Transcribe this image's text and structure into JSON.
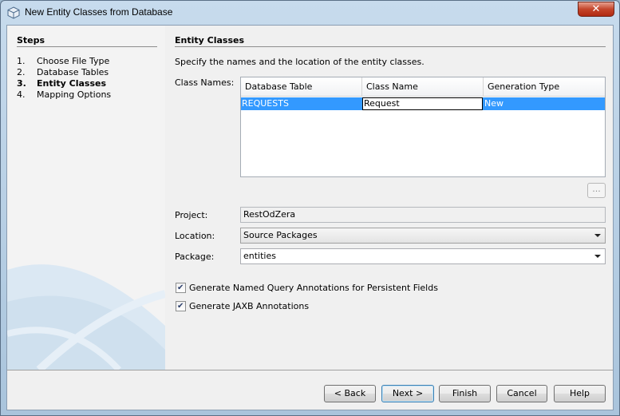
{
  "window": {
    "title": "New Entity Classes from Database",
    "close_glyph": "✕"
  },
  "steps": {
    "title": "Steps",
    "items": [
      {
        "num": "1.",
        "label": "Choose File Type",
        "current": false
      },
      {
        "num": "2.",
        "label": "Database Tables",
        "current": false
      },
      {
        "num": "3.",
        "label": "Entity Classes",
        "current": true
      },
      {
        "num": "4.",
        "label": "Mapping Options",
        "current": false
      }
    ]
  },
  "panel": {
    "title": "Entity Classes",
    "description": "Specify the names and the location of the entity classes.",
    "class_names_label": "Class Names:",
    "table": {
      "columns": [
        "Database Table",
        "Class Name",
        "Generation Type"
      ],
      "rows": [
        [
          "REQUESTS",
          "Request",
          "New"
        ]
      ]
    },
    "ellipsis_label": "...",
    "project_label": "Project:",
    "project_value": "RestOdZera",
    "location_label": "Location:",
    "location_value": "Source Packages",
    "package_label": "Package:",
    "package_value": "entities",
    "checkboxes": [
      {
        "label": "Generate Named Query Annotations for Persistent Fields",
        "checked": true
      },
      {
        "label": "Generate JAXB Annotations",
        "checked": true
      }
    ]
  },
  "buttons": {
    "back": "< Back",
    "next": "Next >",
    "finish": "Finish",
    "cancel": "Cancel",
    "help": "Help"
  },
  "colors": {
    "selection": "#3399ff",
    "title_bar": "#bcd3e8",
    "close": "#c4452b"
  },
  "icons": {
    "title": "cube-icon",
    "checkbox": "checkmark-icon",
    "combo": "chevron-down-icon"
  }
}
